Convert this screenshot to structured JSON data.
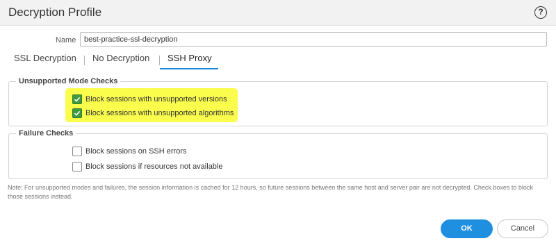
{
  "dialog": {
    "title": "Decryption Profile",
    "help_label": "?"
  },
  "name_field": {
    "label": "Name",
    "value": "best-practice-ssl-decryption"
  },
  "tabs": [
    {
      "label": "SSL Decryption",
      "active": false
    },
    {
      "label": "No Decryption",
      "active": false
    },
    {
      "label": "SSH Proxy",
      "active": true
    }
  ],
  "unsupported_mode_checks": {
    "legend": "Unsupported Mode Checks",
    "highlight_color": "#fbfd4d",
    "options": [
      {
        "label": "Block sessions with unsupported versions",
        "checked": true
      },
      {
        "label": "Block sessions with unsupported algorithms",
        "checked": true
      }
    ]
  },
  "failure_checks": {
    "legend": "Failure Checks",
    "options": [
      {
        "label": "Block sessions on SSH errors",
        "checked": false
      },
      {
        "label": "Block sessions if resources not available",
        "checked": false
      }
    ]
  },
  "note": "Note: For unsupported modes and failures, the session information is cached for 12 hours, so future sessions between the same host and server pair are not decrypted. Check boxes to block those sessions instead.",
  "buttons": {
    "ok": "OK",
    "cancel": "Cancel"
  },
  "colors": {
    "accent": "#1f8fe0",
    "tab_underline": "#1e88d6",
    "checkbox_checked": "#3f9b3f"
  }
}
